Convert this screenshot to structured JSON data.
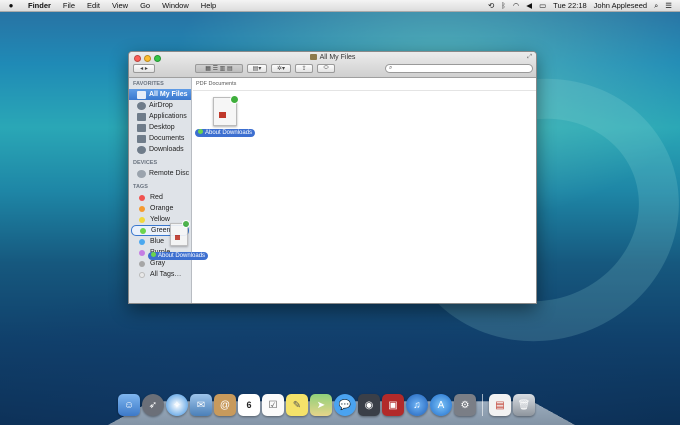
{
  "menubar": {
    "apple": "",
    "app_name": "Finder",
    "items": [
      "File",
      "Edit",
      "View",
      "Go",
      "Window",
      "Help"
    ],
    "clock": "Tue 22:18",
    "user": "John Appleseed"
  },
  "window": {
    "title": "All My Files",
    "search_placeholder": ""
  },
  "sidebar": {
    "favorites_header": "FAVORITES",
    "favorites": [
      "All My Files",
      "AirDrop",
      "Applications",
      "Desktop",
      "Documents",
      "Downloads"
    ],
    "devices_header": "DEVICES",
    "devices": [
      "Remote Disc"
    ],
    "tags_header": "TAGS",
    "tags": [
      {
        "name": "Red",
        "color": "#f0524f"
      },
      {
        "name": "Orange",
        "color": "#f59a30"
      },
      {
        "name": "Yellow",
        "color": "#f1d83c"
      },
      {
        "name": "Green",
        "color": "#6bd44c"
      },
      {
        "name": "Blue",
        "color": "#4aa8ef"
      },
      {
        "name": "Purple",
        "color": "#c57de3"
      },
      {
        "name": "Gray",
        "color": "#a6a6a6"
      },
      {
        "name": "All Tags…",
        "color": "#e8e8e8"
      }
    ]
  },
  "content": {
    "group_header": "PDF Documents",
    "file_name": "About Downloads",
    "drag_label": "About Downloads"
  },
  "dock": {
    "apps": [
      "Finder",
      "Launchpad",
      "Safari",
      "Mail",
      "Contacts",
      "Calendar",
      "Reminders",
      "Notes",
      "Maps",
      "Messages",
      "FaceTime",
      "Photo Booth",
      "iTunes",
      "App Store",
      "System Preferences",
      "Documents",
      "Trash"
    ],
    "calendar_day": "6"
  }
}
